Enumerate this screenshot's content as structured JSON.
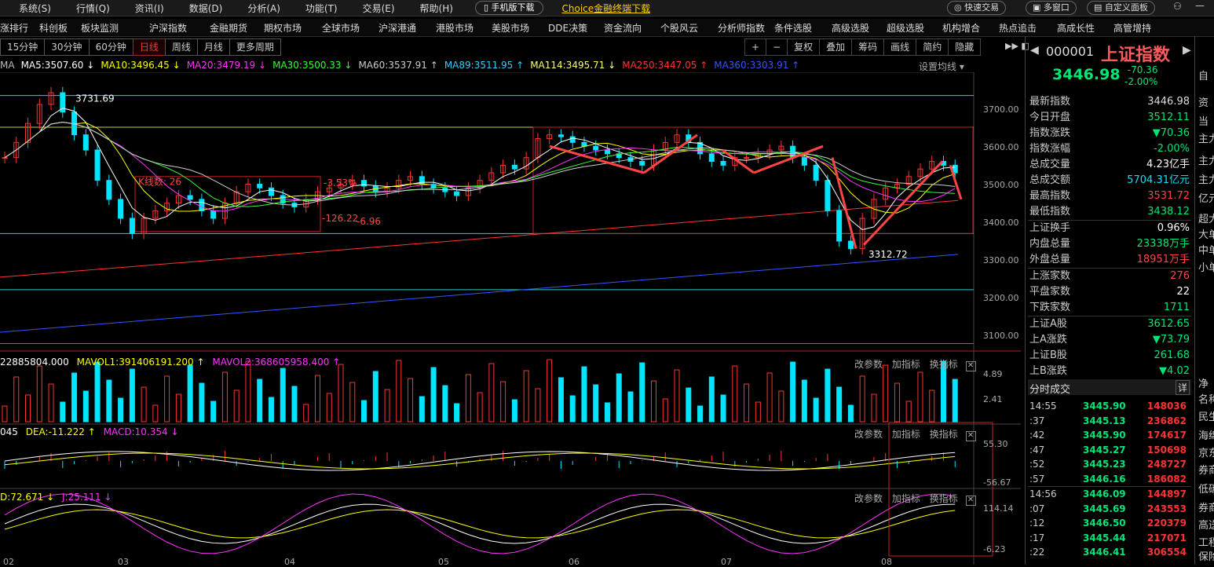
{
  "menu": [
    "系统(S)",
    "行情(Q)",
    "资讯(I)",
    "数据(D)",
    "分析(A)",
    "功能(T)",
    "交易(E)",
    "帮助(H)"
  ],
  "mobile_download": "手机版下载",
  "choice_download": "Choice金融终端下载",
  "top_right": {
    "quick_trade": "快速交易",
    "multi_window": "多窗口",
    "custom_panel": "自定义面板"
  },
  "nav": [
    "涨排行",
    "科创板",
    "板块监测",
    "沪深指数",
    "金融期货",
    "期权市场",
    "全球市场",
    "沪深港通",
    "港股市场",
    "美股市场",
    "DDE决策",
    "资金流向",
    "个股风云",
    "分析师指数",
    "条件选股",
    "高级选股",
    "超级选股",
    "机构增合",
    "热点追击",
    "高成长性",
    "高管增持"
  ],
  "timeframes": [
    "15分钟",
    "30分钟",
    "60分钟",
    "日线",
    "周线",
    "月线",
    "更多周期"
  ],
  "active_timeframe": "日线",
  "toolbar": [
    "+",
    "−",
    "复权",
    "叠加",
    "筹码",
    "画线",
    "简约",
    "隐藏"
  ],
  "ma": [
    {
      "label": "MA",
      "color": "#bbbbbb"
    },
    {
      "label": "MA5:3507.60",
      "color": "#ffffff"
    },
    {
      "label": "MA10:3496.45",
      "color": "#ffff00"
    },
    {
      "label": "MA20:3479.19",
      "color": "#ff33ff"
    },
    {
      "label": "MA30:3500.33",
      "color": "#33ff33"
    },
    {
      "label": "MA60:3537.91",
      "color": "#cccccc"
    },
    {
      "label": "MA89:3511.95",
      "color": "#33ccff"
    },
    {
      "label": "MA114:3495.71",
      "color": "#ffff66"
    },
    {
      "label": "MA250:3447.05",
      "color": "#ff3333"
    },
    {
      "label": "MA360:3303.91",
      "color": "#3355ff"
    }
  ],
  "set_ma": "设置均线",
  "price_axis": [
    "3700.00",
    "3600.00",
    "3500.00",
    "3400.00",
    "3300.00",
    "3200.00",
    "3100.00"
  ],
  "annotations": {
    "high": "3731.69",
    "low": "3312.72",
    "k_count": "K线数: 26",
    "pct": "-3.53%",
    "pts": "-126.22",
    "pct2": "-6.96"
  },
  "vol_legend": {
    "v": "22885804.000",
    "mavol1": "MAVOL1:391406191.200",
    "mavol2": "MAVOL2:368605958.400"
  },
  "vol_axis": [
    "4.89",
    "2.41"
  ],
  "macd_legend": {
    "diff": "045",
    "dea": "DEA:-11.222",
    "macd": "MACD:10.354"
  },
  "macd_axis": [
    "55.30",
    "-56.67"
  ],
  "kdj_legend": {
    "d": "D:72.671",
    "j": "J:25.111"
  },
  "kdj_axis": [
    "114.14",
    "-6.23"
  ],
  "panel_buttons": [
    "改参数",
    "加指标",
    "换指标"
  ],
  "date_axis": [
    "02",
    "03",
    "04",
    "05",
    "06",
    "07",
    "08"
  ],
  "right_panel": {
    "code": "000001",
    "name": "上证指数",
    "price": "3446.98",
    "change": "-70.36",
    "change_pct": "-2.00%",
    "rows": [
      {
        "l": "最新指数",
        "v": "3446.98",
        "c": "#dddddd"
      },
      {
        "l": "今日开盘",
        "v": "3512.11",
        "c": "#00e676"
      },
      {
        "l": "指数涨跌",
        "v": "▼70.36",
        "c": "#00e676"
      },
      {
        "l": "指数涨幅",
        "v": "-2.00%",
        "c": "#00e676"
      },
      {
        "l": "总成交量",
        "v": "4.23亿手",
        "c": "#ffffff"
      },
      {
        "l": "总成交额",
        "v": "5704.31亿元",
        "c": "#00e5ff"
      },
      {
        "l": "最高指数",
        "v": "3531.72",
        "c": "#ff4444"
      },
      {
        "l": "最低指数",
        "v": "3438.12",
        "c": "#00e676"
      },
      {
        "l": "上证换手",
        "v": "0.96%",
        "c": "#ffffff"
      },
      {
        "l": "内盘总量",
        "v": "23338万手",
        "c": "#00e676"
      },
      {
        "l": "外盘总量",
        "v": "18951万手",
        "c": "#ff4444"
      },
      {
        "l": "上涨家数",
        "v": "276",
        "c": "#ff4444"
      },
      {
        "l": "平盘家数",
        "v": "22",
        "c": "#ffffff"
      },
      {
        "l": "下跌家数",
        "v": "1711",
        "c": "#00e676"
      },
      {
        "l": "上证A股",
        "v": "3612.65",
        "c": "#00e676"
      },
      {
        "l": "上A涨跌",
        "v": "▼73.79",
        "c": "#00e676"
      },
      {
        "l": "上证B股",
        "v": "261.68",
        "c": "#00e676"
      },
      {
        "l": "上B涨跌",
        "v": "▼4.02",
        "c": "#00e676"
      }
    ],
    "tick_title": "分时成交",
    "tick_detail": "详",
    "ticks": [
      {
        "t": "14:55",
        "p": "3445.90",
        "v": "148036"
      },
      {
        "t": ":37",
        "p": "3445.13",
        "v": "236862"
      },
      {
        "t": ":42",
        "p": "3445.90",
        "v": "174617"
      },
      {
        "t": ":47",
        "p": "3445.27",
        "v": "150698"
      },
      {
        "t": ":52",
        "p": "3445.23",
        "v": "248727"
      },
      {
        "t": ":57",
        "p": "3446.16",
        "v": "186082"
      },
      {
        "t": "14:56",
        "p": "3446.09",
        "v": "144897"
      },
      {
        "t": ":07",
        "p": "3445.69",
        "v": "243553"
      },
      {
        "t": ":12",
        "p": "3446.50",
        "v": "220379"
      },
      {
        "t": ":17",
        "p": "3445.44",
        "v": "217071"
      },
      {
        "t": ":22",
        "p": "3446.41",
        "v": "306554"
      }
    ]
  },
  "far_right": [
    "自",
    "资",
    "当",
    "主力",
    "主力",
    "主力",
    "亿元",
    "超大",
    "大单",
    "中单",
    "小单",
    "净",
    "名称",
    "民生",
    "海绵",
    "京东",
    "券商",
    "低碳",
    "券商",
    "高送",
    "工程",
    "保险"
  ]
}
